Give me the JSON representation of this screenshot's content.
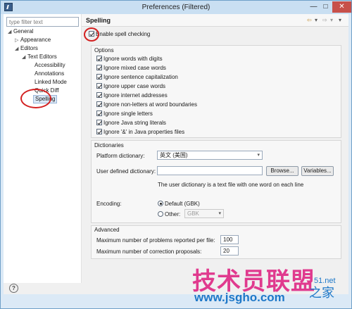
{
  "window": {
    "title": "Preferences (Filtered)",
    "minimize": "—",
    "maximize": "□",
    "close": "✕"
  },
  "sidebar": {
    "filter_placeholder": "type filter text",
    "tree": [
      {
        "label": "General",
        "arrow": "◢"
      },
      {
        "label": "Appearance",
        "arrow": "▷"
      },
      {
        "label": "Editors",
        "arrow": "◢"
      },
      {
        "label": "Text Editors",
        "arrow": "◢"
      },
      {
        "label": "Accessibility"
      },
      {
        "label": "Annotations"
      },
      {
        "label": "Linked Mode"
      },
      {
        "label": "Quick Diff"
      },
      {
        "label": "Spelling",
        "selected": true
      }
    ]
  },
  "header": {
    "title": "Spelling",
    "back_icon": "⇦",
    "forward_icon": "⇨",
    "menu_icon": "▾"
  },
  "enable_spell_checking": {
    "label": "Enable spell checking",
    "checked": true
  },
  "options": {
    "title": "Options",
    "items": [
      {
        "label": "Ignore words with digits",
        "checked": true
      },
      {
        "label": "Ignore mixed case words",
        "checked": true
      },
      {
        "label": "Ignore sentence capitalization",
        "checked": true
      },
      {
        "label": "Ignore upper case words",
        "checked": true
      },
      {
        "label": "Ignore internet addresses",
        "checked": true
      },
      {
        "label": "Ignore non-letters at word boundaries",
        "checked": true
      },
      {
        "label": "Ignore single letters",
        "checked": true
      },
      {
        "label": "Ignore Java string literals",
        "checked": true
      },
      {
        "label": "Ignore '&' in Java properties files",
        "checked": true
      }
    ]
  },
  "dictionaries": {
    "title": "Dictionaries",
    "platform_label": "Platform dictionary:",
    "platform_value": "英文 (美国)",
    "user_label": "User defined dictionary:",
    "user_value": "",
    "browse_label": "Browse...",
    "variables_label": "Variables...",
    "hint": "The user dictionary is a text file with one word on each line",
    "encoding_label": "Encoding:",
    "default_label": "Default (GBK)",
    "other_label": "Other:",
    "other_value": "GBK"
  },
  "advanced": {
    "title": "Advanced",
    "max_problems_label": "Maximum number of problems reported per file:",
    "max_problems_value": "100",
    "max_proposals_label": "Maximum number of correction proposals:",
    "max_proposals_value": "20"
  },
  "footer": {
    "help_icon": "?"
  },
  "watermark": {
    "main": "技术员联盟",
    "url": "www.jsgho.com",
    "suffix": "之家",
    "partial": "51.net"
  },
  "colors": {
    "annotation": "#d32020",
    "watermark_pink": "#e03a8e",
    "watermark_blue": "#1e78c8"
  }
}
